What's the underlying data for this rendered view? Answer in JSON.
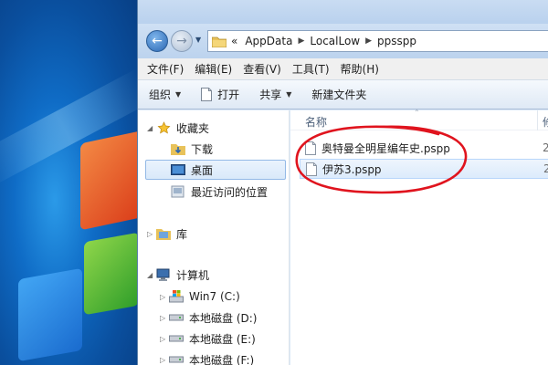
{
  "address_bar": {
    "overflow_marker": "«",
    "crumbs": [
      "AppData",
      "LocalLow",
      "ppsspp"
    ]
  },
  "menu": [
    "文件(F)",
    "编辑(E)",
    "查看(V)",
    "工具(T)",
    "帮助(H)"
  ],
  "toolbar": {
    "organize": "组织",
    "open": "打开",
    "share": "共享",
    "new_folder": "新建文件夹"
  },
  "nav": {
    "favorites": "收藏夹",
    "downloads": "下载",
    "desktop": "桌面",
    "recent": "最近访问的位置",
    "libraries": "库",
    "computer": "计算机",
    "drives": [
      "Win7 (C:)",
      "本地磁盘 (D:)",
      "本地磁盘 (E:)",
      "本地磁盘 (F:)"
    ]
  },
  "content": {
    "column_name": "名称",
    "column_partial": "修",
    "files": [
      {
        "name": "奥特曼全明星编年史.pspp",
        "date_partial": "2"
      },
      {
        "name": "伊苏3.pspp",
        "date_partial": "2"
      }
    ]
  },
  "annotation_color": "#e0141e"
}
